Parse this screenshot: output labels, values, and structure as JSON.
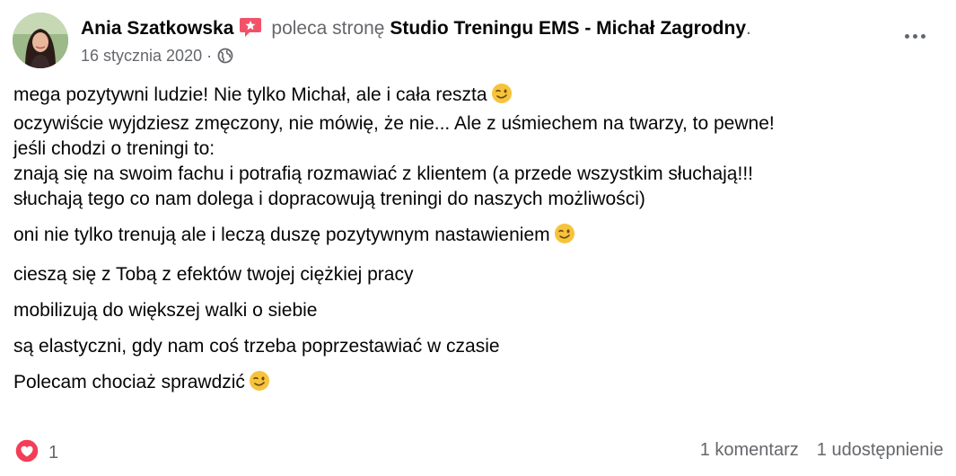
{
  "post": {
    "author": "Ania Szatkowska",
    "action": "poleca stronę",
    "page_name": "Studio Treningu EMS - Michał Zagrodny",
    "title_period": ".",
    "date": "16 stycznia 2020",
    "meta_separator": "·",
    "privacy_icon": "globe-icon",
    "recommend_icon": "recommend-badge-icon",
    "more_icon": "more-dots-icon"
  },
  "content": {
    "para1": [
      "mega pozytywni ludzie! Nie tylko Michał, ale i cała reszta",
      "oczywiście wyjdziesz zmęczony, nie mówię, że nie... Ale z uśmiechem na twarzy, to pewne!",
      "jeśli chodzi o treningi to:",
      "znają się na swoim fachu i potrafią rozmawiać z klientem (a przede wszystkim słuchają!!!",
      "słuchają tego co nam dolega i dopracowują treningi do naszych możliwości)"
    ],
    "para2": "oni nie tylko trenują ale i leczą duszę pozytywnym nastawieniem",
    "para3": "cieszą się z Tobą z efektów twojej ciężkiej pracy",
    "para4": "mobilizują do większej walki o siebie",
    "para5": "są elastyczni, gdy nam coś trzeba poprzestawiać w czasie",
    "para6": "Polecam chociaż sprawdzić",
    "emoji": "winking-face-emoji"
  },
  "footer": {
    "reaction_icon": "heart-reaction-icon",
    "reaction_count": "1",
    "comments": "1 komentarz",
    "shares": "1 udostępnienie"
  },
  "colors": {
    "text": "#050505",
    "muted": "#65676b",
    "heart": "#f33e58",
    "recommend_badge": "#f25268",
    "emoji_face": "#f7c33b"
  }
}
